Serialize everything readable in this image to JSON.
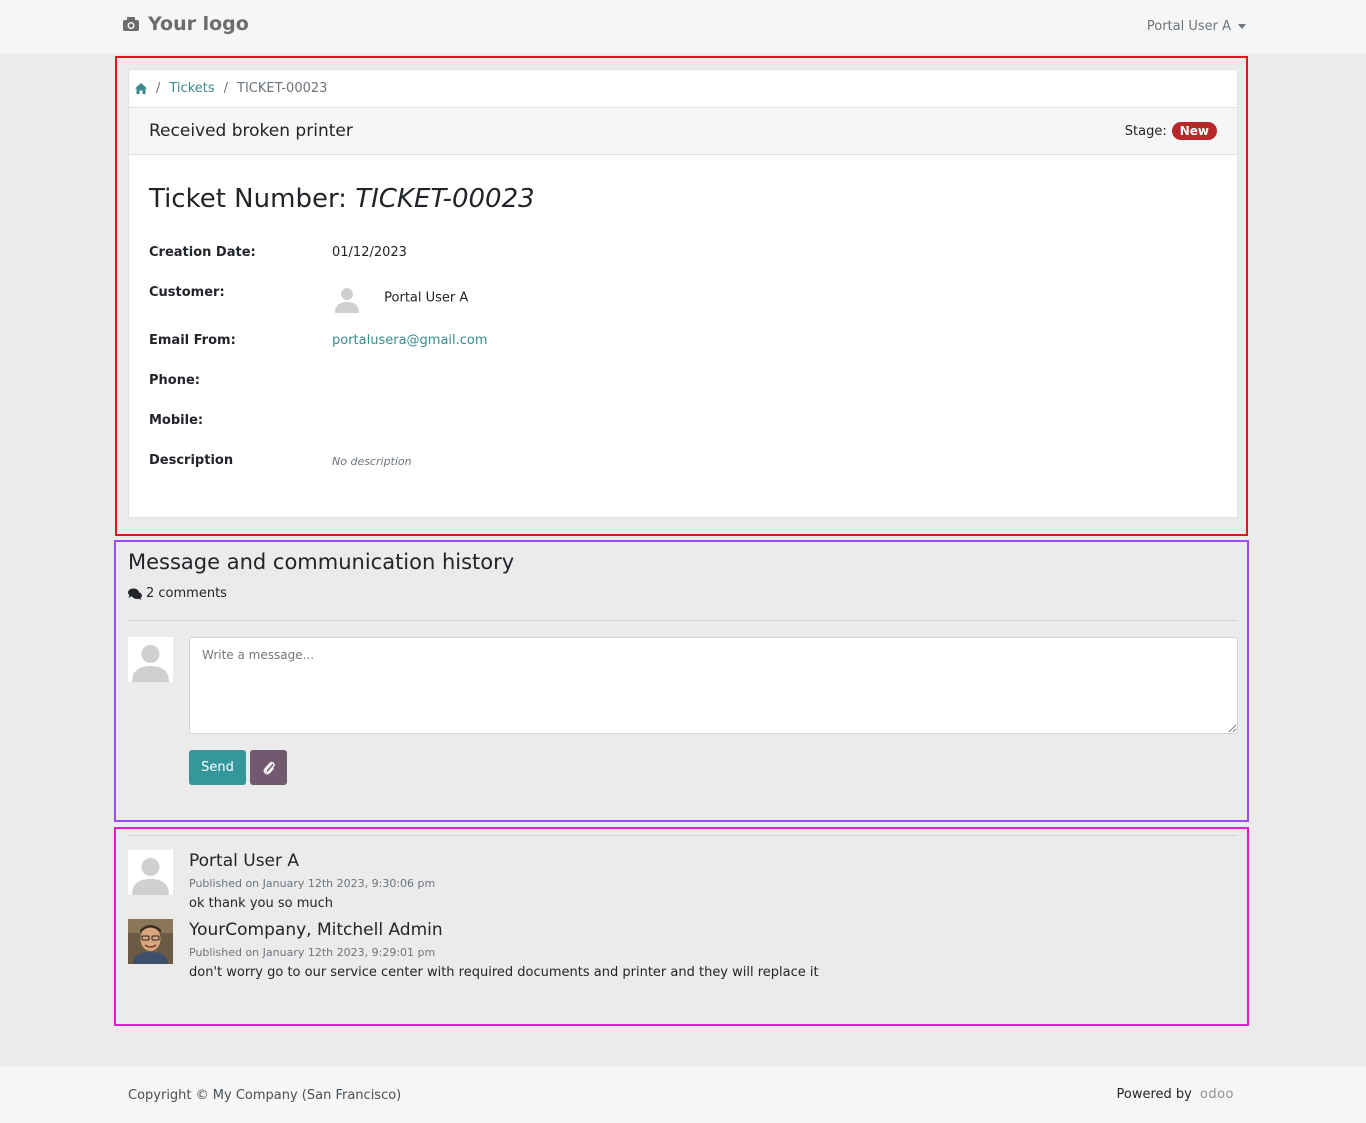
{
  "header": {
    "logo_text": "Your logo",
    "user_menu": "Portal User A"
  },
  "breadcrumb": {
    "tickets": "Tickets",
    "current": "TICKET-00023"
  },
  "ticket": {
    "subject": "Received broken printer",
    "stage_label": "Stage:",
    "stage_value": "New",
    "number_label": "Ticket Number:",
    "number_value": "TICKET-00023",
    "fields": {
      "creation_date_label": "Creation Date:",
      "creation_date": "01/12/2023",
      "customer_label": "Customer:",
      "customer": "Portal User A",
      "email_label": "Email From:",
      "email": "portalusera@gmail.com",
      "phone_label": "Phone:",
      "mobile_label": "Mobile:",
      "description_label": "Description",
      "description": "No description"
    }
  },
  "chatter": {
    "title": "Message and communication history",
    "comments_count": "2 comments",
    "input_placeholder": "Write a message...",
    "send_label": "Send"
  },
  "messages": [
    {
      "author": "Portal User A",
      "date": "Published on January 12th 2023, 9:30:06 pm",
      "body": "ok thank you so much"
    },
    {
      "author": "YourCompany, Mitchell Admin",
      "date": "Published on January 12th 2023, 9:29:01 pm",
      "body": "don't worry go to our service center with required documents and printer and they will replace it"
    }
  ],
  "footer": {
    "copyright": "Copyright © My Company (San Francisco)",
    "powered_by": "Powered by",
    "odoo_logo": "odoo"
  },
  "colors": {
    "accent": "#35979c",
    "link": "#3a8a8f",
    "stage_badge": "#b6282a",
    "attach_button": "#71596f"
  }
}
